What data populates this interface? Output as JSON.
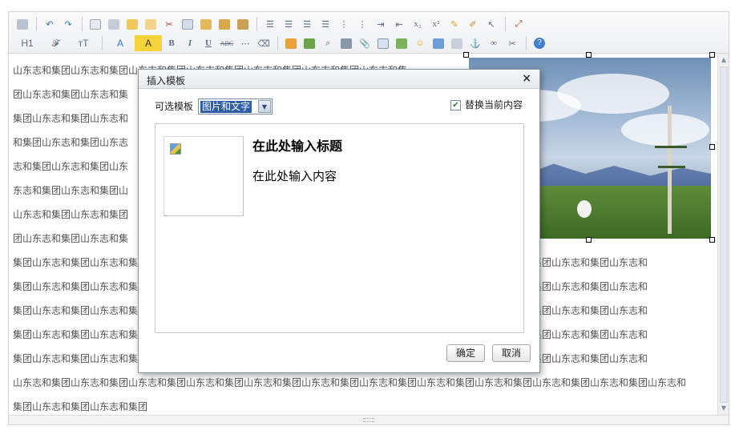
{
  "toolbar": {
    "row1": [
      "source-icon",
      "undo-icon",
      "redo-icon",
      "preview-icon",
      "print-icon",
      "template-icon",
      "paste-plain-icon",
      "cut-icon",
      "copy-icon",
      "paste-icon",
      "paste-word-icon",
      "paste-text-icon",
      "align-left-icon",
      "align-center-icon",
      "align-right-icon",
      "justify-icon",
      "ordered-list-icon",
      "bullet-list-icon",
      "indent-icon",
      "outdent-icon",
      "subscript-icon",
      "superscript-icon",
      "clear-format-icon",
      "format-painter-icon",
      "select-all-icon",
      "maximize-icon"
    ],
    "row2": {
      "heading": "H1",
      "font_family": "𝓕",
      "font_size": "ᴛT",
      "font_color": "A",
      "bg_color": "A",
      "bold": "B",
      "italic": "I",
      "underline": "U",
      "strikethrough": "ABC"
    }
  },
  "content": {
    "lines": [
      "山东志和集团山东志和集团山东志和集团山东志和集团山东志和集团山东志和集团山东志和集",
      "团山东志和集团山东志和集",
      "集团山东志和集团山东志和",
      "和集团山东志和集团山东志",
      "志和集团山东志和集团山东",
      "东志和集团山东志和集团山",
      "山东志和集团山东志和集团",
      "团山东志和集团山东志和集",
      "集团山东志和集团山东志和集团山东志和集团山东志和集团山东志和集团山东志和集团山东志和集团山东志和集团山东志和集团山东志和集团山东志和",
      "集团山东志和集团山东志和集团山东志和集团山东志和集团山东志和集团山东志和集团山东志和集团山东志和集团山东志和集团山东志和集团山东志和",
      "集团山东志和集团山东志和集团山东志和集团山东志和集团山东志和集团山东志和集团山东志和集团山东志和集团山东志和集团山东志和集团山东志和",
      "集团山东志和集团山东志和集团山东志和集团山东志和集团山东志和集团山东志和集团山东志和集团山东志和集团山东志和集团山东志和集团山东志和",
      "集团山东志和集团山东志和集团山东志和集团山东志和集团山东志和集团山东志和集团山东志和集团山东志和集团山东志和集团山东志和集团山东志和",
      "山东志和集团山东志和集团山东志和集团山东志和集团山东志和集团山东志和集团山东志和集团山东志和集团山东志和集团山东志和集团山东志和集团山东志和",
      "集团山东志和集团山东志和集团"
    ]
  },
  "dialog": {
    "title": "插入模板",
    "close": "×",
    "template_label": "可选模板",
    "template_selected": "图片和文字",
    "replace_label": "替换当前内容",
    "replace_checked": "✔",
    "preview_title": "在此处输入标题",
    "preview_body": "在此处输入内容",
    "ok": "确定",
    "cancel": "取消"
  },
  "colors": {
    "selection": "#2f5ea6",
    "border": "#8a95a4"
  }
}
